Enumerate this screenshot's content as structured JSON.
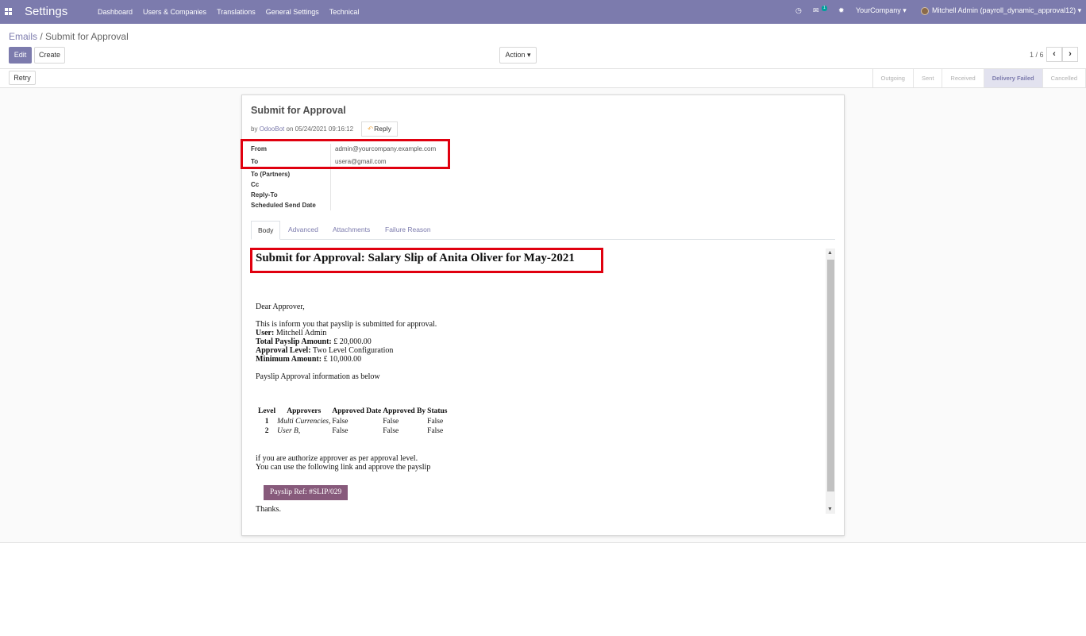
{
  "navbar": {
    "brand": "Settings",
    "menu": [
      "Dashboard",
      "Users & Companies",
      "Translations",
      "General Settings",
      "Technical"
    ],
    "chat_badge": "1",
    "company": "YourCompany",
    "user": "Mitchell Admin (payroll_dynamic_approval12)"
  },
  "breadcrumb": {
    "parent": "Emails",
    "separator": "/",
    "current": "Submit for Approval"
  },
  "buttons": {
    "edit": "Edit",
    "create": "Create",
    "action": "Action",
    "retry": "Retry"
  },
  "pager": {
    "value": "1 / 6"
  },
  "stages": [
    "Outgoing",
    "Sent",
    "Received",
    "Delivery Failed",
    "Cancelled"
  ],
  "active_stage": "Delivery Failed",
  "email": {
    "subject": "Submit for Approval",
    "by_prefix": "by",
    "author": "OdooBot",
    "on_prefix": "on",
    "date": "05/24/2021 09:16:12",
    "reply_label": "Reply",
    "fields": [
      {
        "label": "From",
        "value": "admin@yourcompany.example.com"
      },
      {
        "label": "To",
        "value": "usera@gmail.com"
      },
      {
        "label": "To (Partners)",
        "value": ""
      },
      {
        "label": "Cc",
        "value": ""
      },
      {
        "label": "Reply-To",
        "value": ""
      },
      {
        "label": "Scheduled Send Date",
        "value": ""
      }
    ]
  },
  "tabs": [
    "Body",
    "Advanced",
    "Attachments",
    "Failure Reason"
  ],
  "active_tab": "Body",
  "mail_body": {
    "heading": "Submit for Approval: Salary Slip of Anita Oliver for May-2021",
    "greeting": "Dear Approver,",
    "intro": "This is inform you that payslip is submitted for approval.",
    "user_label": "User:",
    "user_value": "Mitchell Admin",
    "total_label": "Total Payslip Amount:",
    "total_value": "£ 20,000.00",
    "level_label": "Approval Level:",
    "level_value": "Two Level Configuration",
    "min_label": "Minimum Amount:",
    "min_value": "£ 10,000.00",
    "info": "Payslip Approval information as below",
    "table_headers": [
      "Level",
      "Approvers",
      "Approved Date",
      "Approved By",
      "Status"
    ],
    "table_rows": [
      {
        "level": "1",
        "approver": "Multi Currencies",
        "approver_suffix": ",",
        "date": "False",
        "by": "False",
        "status": "False"
      },
      {
        "level": "2",
        "approver": "User B",
        "approver_suffix": ",",
        "date": "False",
        "by": "False",
        "status": "False"
      }
    ],
    "note1": "if you are authorize approver as per approval level.",
    "note2": "You can use the following link and approve the payslip",
    "payslip_button": "Payslip Ref: #SLIP/029",
    "thanks": "Thanks."
  },
  "colors": {
    "brand": "#7c7bad",
    "highlight_box": "#e0000f",
    "payslip_button": "#875a7b"
  }
}
